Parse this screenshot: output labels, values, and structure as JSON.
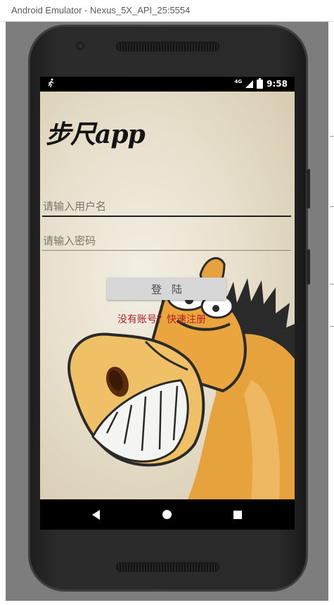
{
  "window": {
    "title": "Android Emulator - Nexus_5X_API_25:5554"
  },
  "status_bar": {
    "network": "4G",
    "time": "9:58"
  },
  "app": {
    "logo": "步尺app",
    "username_placeholder": "请输入用户名",
    "password_placeholder": "请输入密码",
    "login_label": "登陆",
    "register_link": "没有账号？快速注册"
  },
  "nav": {
    "back": "back-icon",
    "home": "home-icon",
    "recents": "recents-icon"
  }
}
